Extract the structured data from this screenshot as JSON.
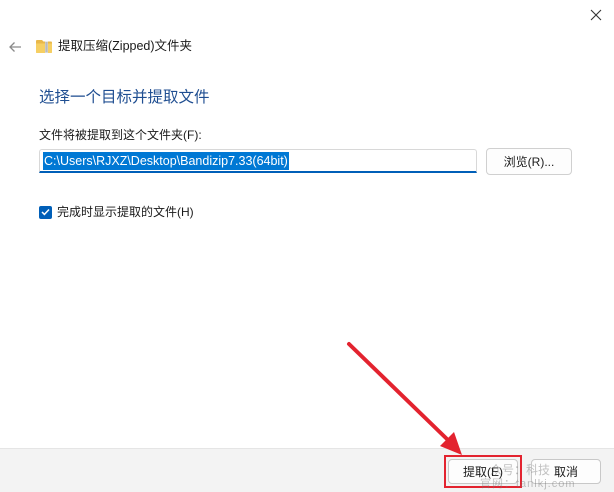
{
  "window": {
    "title": "提取压缩(Zipped)文件夹"
  },
  "main": {
    "heading": "选择一个目标并提取文件",
    "folder_label": "文件将被提取到这个文件夹(F):",
    "path_value": "C:\\Users\\RJXZ\\Desktop\\Bandizip7.33(64bit)",
    "browse_label": "浏览(R)...",
    "show_files_checked": true,
    "show_files_label": "完成时显示提取的文件(H)"
  },
  "footer": {
    "extract_label": "提取(E)",
    "cancel_label": "取消"
  },
  "watermark": {
    "line1": "众号：科技",
    "line2": "官网：tanlkj.com"
  },
  "icons": {
    "close": "close-icon",
    "back": "back-arrow-icon",
    "folder": "zip-folder-icon",
    "check": "check-icon"
  },
  "colors": {
    "accent": "#005fb8",
    "heading": "#1f4e91",
    "selection": "#0078d4",
    "annotation": "#e3232f"
  }
}
